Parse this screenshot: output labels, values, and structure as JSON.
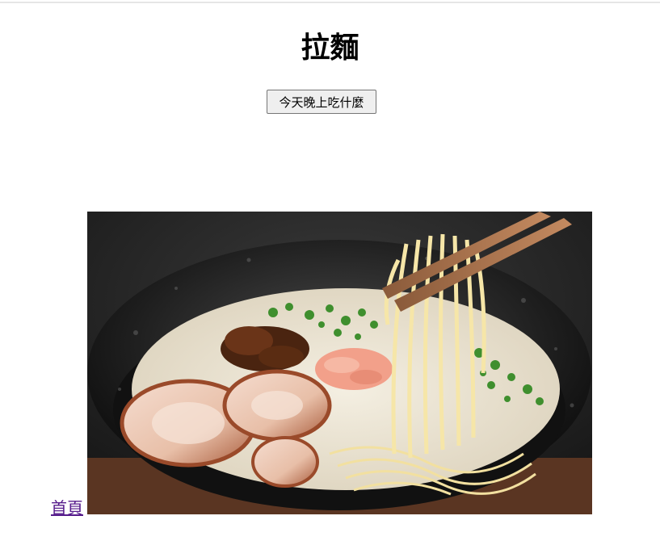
{
  "page": {
    "title": "拉麵",
    "action_button_label": "今天晚上吃什麼",
    "home_link_label": "首頁"
  },
  "image": {
    "subject": "ramen-bowl-photo"
  },
  "colors": {
    "link": "#551a8b",
    "button_bg": "#efefef",
    "button_border": "#767676"
  }
}
